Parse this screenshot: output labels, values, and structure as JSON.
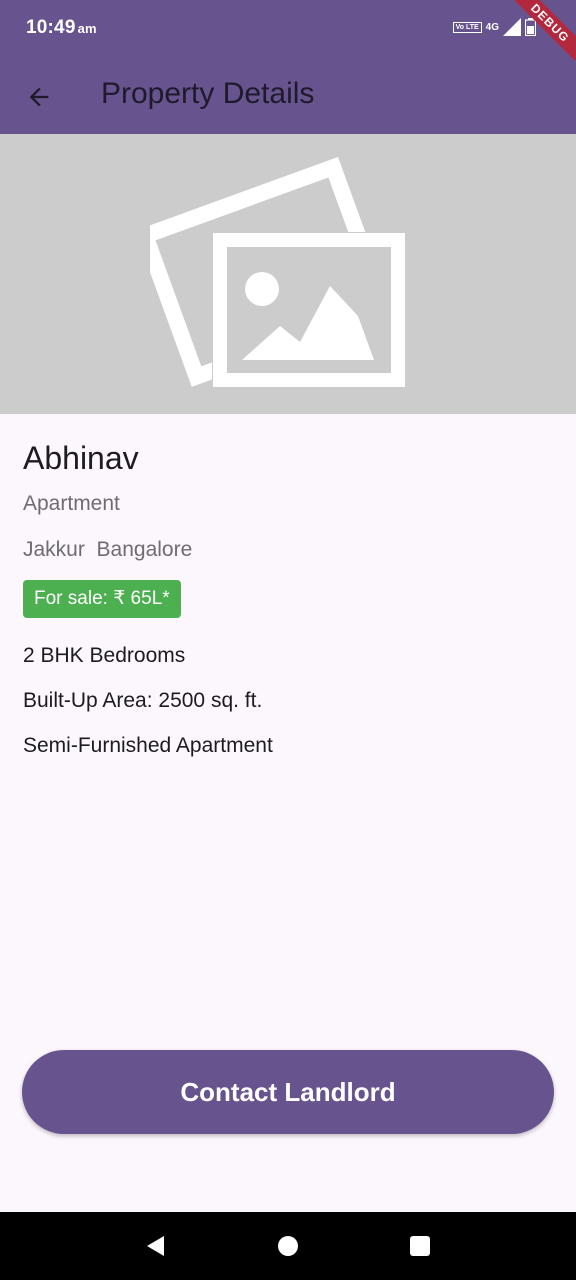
{
  "status_bar": {
    "time": "10:49",
    "ampm": "am",
    "volte": "Vo LTE",
    "network": "4G",
    "debug_label": "DEBUG"
  },
  "app_bar": {
    "title": "Property Details",
    "back_icon": "arrow-back-icon",
    "background": "#67548e"
  },
  "hero": {
    "placeholder_icon": "image-placeholder-icon",
    "background": "#cccccc"
  },
  "property": {
    "owner": "Abhinav",
    "type": "Apartment",
    "location": "Jakkur  Bangalore",
    "price_badge": "For sale: ₹ 65L*",
    "bedrooms": "2 BHK Bedrooms",
    "area": "Built-Up Area: 2500 sq. ft.",
    "furnishing": "Semi-Furnished Apartment"
  },
  "actions": {
    "contact_label": "Contact Landlord"
  },
  "nav_bar": {
    "icons": [
      "back-triangle-icon",
      "home-circle-icon",
      "recents-square-icon"
    ]
  },
  "colors": {
    "primary": "#67548e",
    "badge": "#4caf50",
    "page_background": "#fcf6fd"
  }
}
